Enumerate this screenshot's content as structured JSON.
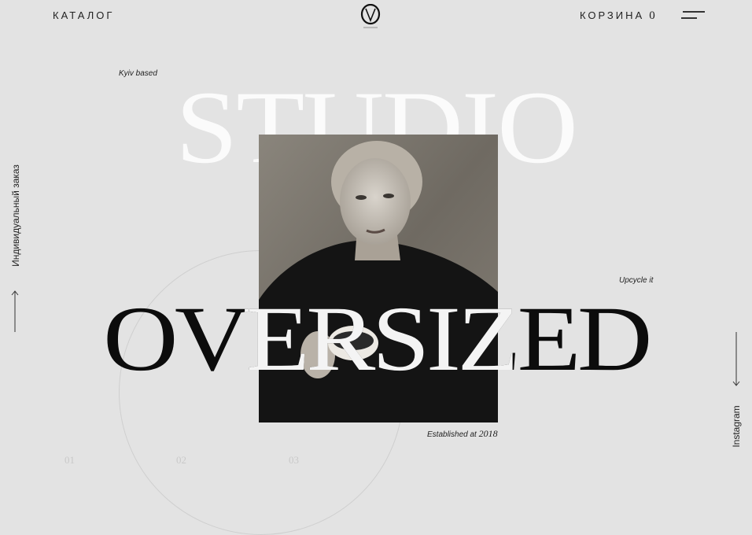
{
  "header": {
    "catalog_label": "КАТАЛОГ",
    "cart_label": "КОРЗИНА",
    "cart_count": "0",
    "logo_icon": "brand-logo-icon",
    "menu_icon": "hamburger-menu-icon"
  },
  "hero": {
    "studio_text": "STUDIO",
    "headline": "OVERSIZED",
    "kyiv_label": "Kyiv based",
    "upcycle_label": "Upcycle it",
    "established_prefix": "Established at",
    "established_year": "2018"
  },
  "side": {
    "left_link": "Индивидуальный заказ",
    "right_link": "Instagram"
  },
  "pagination": [
    "01",
    "02",
    "03"
  ],
  "colors": {
    "background": "#e3e3e3",
    "dark_text": "#0c0c0c",
    "light_text": "#fbfbfb"
  }
}
